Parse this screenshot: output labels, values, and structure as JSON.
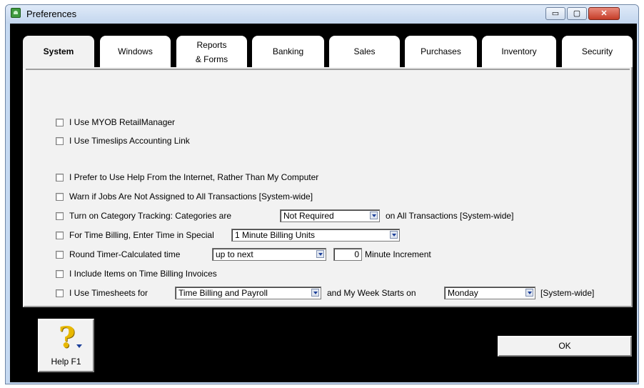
{
  "window": {
    "title": "Preferences",
    "minimize_glyph": "▭",
    "maximize_glyph": "▢",
    "close_glyph": "✕"
  },
  "tabs": [
    {
      "label": "System",
      "active": true
    },
    {
      "label": "Windows",
      "active": false
    },
    {
      "label_line1": "Reports",
      "label_line2": "& Forms",
      "active": false
    },
    {
      "label": "Banking",
      "active": false
    },
    {
      "label": "Sales",
      "active": false
    },
    {
      "label": "Purchases",
      "active": false
    },
    {
      "label": "Inventory",
      "active": false
    },
    {
      "label": "Security",
      "active": false
    }
  ],
  "options": {
    "retail_manager": "I Use MYOB RetailManager",
    "timeslips": "I Use Timeslips Accounting Link",
    "help_internet": "I Prefer to Use Help From the Internet, Rather Than My Computer",
    "warn_jobs": "Warn if Jobs Are Not Assigned to All Transactions [System-wide]",
    "category_tracking": "Turn on Category Tracking:  Categories are",
    "category_value": "Not Required",
    "category_suffix": "on All Transactions [System-wide]",
    "time_billing": "For Time Billing, Enter Time in Special",
    "time_billing_value": "1 Minute Billing Units",
    "round_timer": "Round Timer-Calculated time",
    "round_timer_value": "up to next",
    "minute_increment_value": "0",
    "minute_increment_label": "Minute Increment",
    "include_items": "I Include Items on Time Billing Invoices",
    "timesheets": "I Use Timesheets for",
    "timesheets_value": "Time Billing and Payroll",
    "week_starts_label": "and My Week Starts on",
    "week_starts_value": "Monday",
    "week_starts_suffix": "[System-wide]"
  },
  "buttons": {
    "help_label": "Help F1",
    "help_icon": "question-mark-icon",
    "help_glyph": "?",
    "ok_label": "OK"
  },
  "colors": {
    "panel_background": "#000000",
    "content_background": "#f2f2f2",
    "titlebar": "#c3d6ee",
    "close_button": "#c53d28"
  }
}
